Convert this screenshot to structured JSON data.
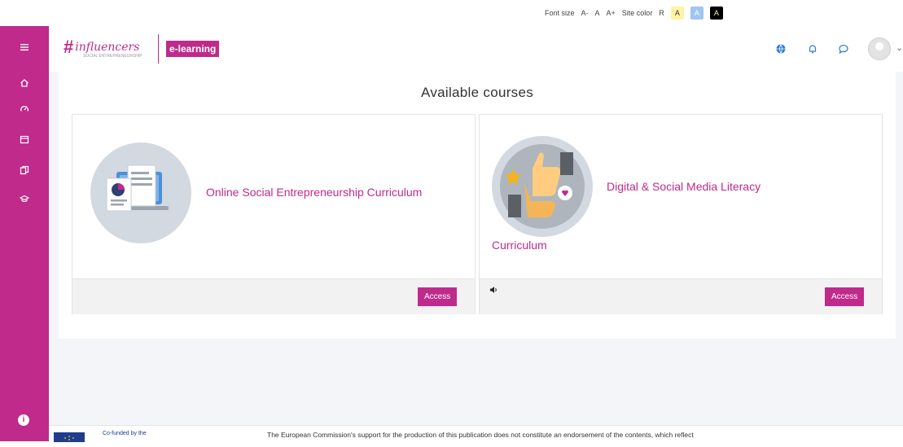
{
  "accessibility": {
    "font_size_label": "Font size",
    "font_decrease": "A-",
    "font_normal": "A",
    "font_increase": "A+",
    "site_color_label": "Site color",
    "color_reset": "R",
    "color_options": [
      "A",
      "A",
      "A"
    ]
  },
  "header": {
    "logo_text": "influencers",
    "logo_subtext": "SOCIAL ENTREPRENEURSHIP",
    "section_label": "e-learning"
  },
  "main": {
    "title": "Available courses",
    "courses": [
      {
        "title": "Online Social Entrepreneurship Curriculum",
        "action_label": "Access"
      },
      {
        "title_line1": "Digital & Social Media Literacy",
        "title_line2": "Curriculum",
        "action_label": "Access"
      }
    ]
  },
  "footer": {
    "cofunded": "Co-funded by the",
    "disclaimer": "The European Commission's support for the production of this publication does not constitute an endorsement of the contents, which reflect"
  },
  "colors": {
    "brand": "#c02a8b",
    "highlight_yellow": "#fff4a3",
    "highlight_blue": "#9ec6ef",
    "highlight_black": "#000000"
  },
  "icons": {
    "sidebar": [
      "menu-icon",
      "home-icon",
      "dashboard-icon",
      "calendar-icon",
      "files-icon",
      "courses-icon"
    ],
    "topnav": [
      "language-icon",
      "bell-icon",
      "chat-icon",
      "avatar"
    ]
  }
}
